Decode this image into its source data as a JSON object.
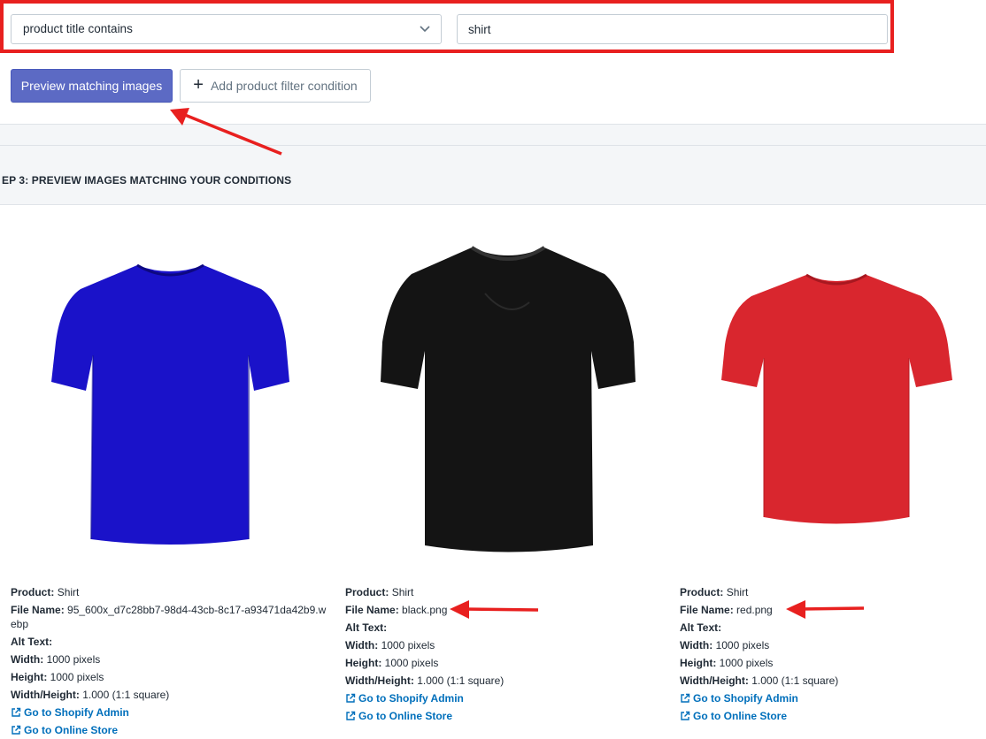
{
  "filter": {
    "condition_select": "product title contains",
    "value_input": "shirt"
  },
  "buttons": {
    "preview_label": "Preview matching images",
    "add_filter_label": "Add product filter condition"
  },
  "step": {
    "title": "EP 3: PREVIEW IMAGES MATCHING YOUR CONDITIONS"
  },
  "labels": {
    "product": "Product:",
    "file_name": "File Name:",
    "alt_text": "Alt Text:",
    "width": "Width:",
    "height": "Height:",
    "ratio": "Width/Height:",
    "admin_link": "Go to Shopify Admin",
    "store_link": "Go to Online Store"
  },
  "colors": {
    "primary": "#5c6ac4",
    "highlight": "#e8201f",
    "link": "#006fbb",
    "shirt_blue": "#1a12c9",
    "shirt_black": "#111111",
    "shirt_red": "#d9262e"
  },
  "products": [
    {
      "product": "Shirt",
      "file_name": "95_600x_d7c28bb7-98d4-43cb-8c17-a93471da42b9.webp",
      "alt_text": "",
      "width": "1000 pixels",
      "height": "1000 pixels",
      "ratio": "1.000 (1:1 square)",
      "color": "blue"
    },
    {
      "product": "Shirt",
      "file_name": "black.png",
      "alt_text": "",
      "width": "1000 pixels",
      "height": "1000 pixels",
      "ratio": "1.000 (1:1 square)",
      "color": "black"
    },
    {
      "product": "Shirt",
      "file_name": "red.png",
      "alt_text": "",
      "width": "1000 pixels",
      "height": "1000 pixels",
      "ratio": "1.000 (1:1 square)",
      "color": "red"
    }
  ]
}
